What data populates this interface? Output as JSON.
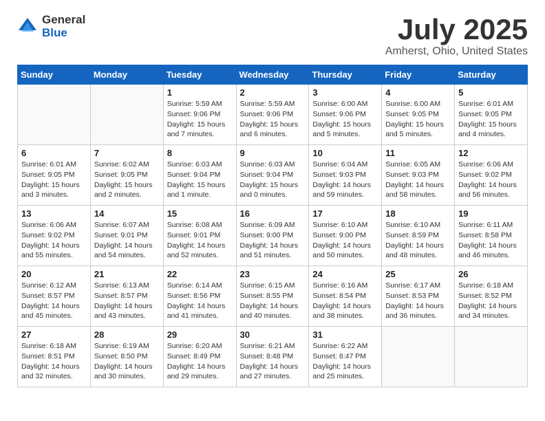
{
  "logo": {
    "general": "General",
    "blue": "Blue"
  },
  "title": "July 2025",
  "location": "Amherst, Ohio, United States",
  "days_of_week": [
    "Sunday",
    "Monday",
    "Tuesday",
    "Wednesday",
    "Thursday",
    "Friday",
    "Saturday"
  ],
  "weeks": [
    [
      {
        "day": "",
        "info": ""
      },
      {
        "day": "",
        "info": ""
      },
      {
        "day": "1",
        "info": "Sunrise: 5:59 AM\nSunset: 9:06 PM\nDaylight: 15 hours\nand 7 minutes."
      },
      {
        "day": "2",
        "info": "Sunrise: 5:59 AM\nSunset: 9:06 PM\nDaylight: 15 hours\nand 6 minutes."
      },
      {
        "day": "3",
        "info": "Sunrise: 6:00 AM\nSunset: 9:06 PM\nDaylight: 15 hours\nand 5 minutes."
      },
      {
        "day": "4",
        "info": "Sunrise: 6:00 AM\nSunset: 9:05 PM\nDaylight: 15 hours\nand 5 minutes."
      },
      {
        "day": "5",
        "info": "Sunrise: 6:01 AM\nSunset: 9:05 PM\nDaylight: 15 hours\nand 4 minutes."
      }
    ],
    [
      {
        "day": "6",
        "info": "Sunrise: 6:01 AM\nSunset: 9:05 PM\nDaylight: 15 hours\nand 3 minutes."
      },
      {
        "day": "7",
        "info": "Sunrise: 6:02 AM\nSunset: 9:05 PM\nDaylight: 15 hours\nand 2 minutes."
      },
      {
        "day": "8",
        "info": "Sunrise: 6:03 AM\nSunset: 9:04 PM\nDaylight: 15 hours\nand 1 minute."
      },
      {
        "day": "9",
        "info": "Sunrise: 6:03 AM\nSunset: 9:04 PM\nDaylight: 15 hours\nand 0 minutes."
      },
      {
        "day": "10",
        "info": "Sunrise: 6:04 AM\nSunset: 9:03 PM\nDaylight: 14 hours\nand 59 minutes."
      },
      {
        "day": "11",
        "info": "Sunrise: 6:05 AM\nSunset: 9:03 PM\nDaylight: 14 hours\nand 58 minutes."
      },
      {
        "day": "12",
        "info": "Sunrise: 6:06 AM\nSunset: 9:02 PM\nDaylight: 14 hours\nand 56 minutes."
      }
    ],
    [
      {
        "day": "13",
        "info": "Sunrise: 6:06 AM\nSunset: 9:02 PM\nDaylight: 14 hours\nand 55 minutes."
      },
      {
        "day": "14",
        "info": "Sunrise: 6:07 AM\nSunset: 9:01 PM\nDaylight: 14 hours\nand 54 minutes."
      },
      {
        "day": "15",
        "info": "Sunrise: 6:08 AM\nSunset: 9:01 PM\nDaylight: 14 hours\nand 52 minutes."
      },
      {
        "day": "16",
        "info": "Sunrise: 6:09 AM\nSunset: 9:00 PM\nDaylight: 14 hours\nand 51 minutes."
      },
      {
        "day": "17",
        "info": "Sunrise: 6:10 AM\nSunset: 9:00 PM\nDaylight: 14 hours\nand 50 minutes."
      },
      {
        "day": "18",
        "info": "Sunrise: 6:10 AM\nSunset: 8:59 PM\nDaylight: 14 hours\nand 48 minutes."
      },
      {
        "day": "19",
        "info": "Sunrise: 6:11 AM\nSunset: 8:58 PM\nDaylight: 14 hours\nand 46 minutes."
      }
    ],
    [
      {
        "day": "20",
        "info": "Sunrise: 6:12 AM\nSunset: 8:57 PM\nDaylight: 14 hours\nand 45 minutes."
      },
      {
        "day": "21",
        "info": "Sunrise: 6:13 AM\nSunset: 8:57 PM\nDaylight: 14 hours\nand 43 minutes."
      },
      {
        "day": "22",
        "info": "Sunrise: 6:14 AM\nSunset: 8:56 PM\nDaylight: 14 hours\nand 41 minutes."
      },
      {
        "day": "23",
        "info": "Sunrise: 6:15 AM\nSunset: 8:55 PM\nDaylight: 14 hours\nand 40 minutes."
      },
      {
        "day": "24",
        "info": "Sunrise: 6:16 AM\nSunset: 8:54 PM\nDaylight: 14 hours\nand 38 minutes."
      },
      {
        "day": "25",
        "info": "Sunrise: 6:17 AM\nSunset: 8:53 PM\nDaylight: 14 hours\nand 36 minutes."
      },
      {
        "day": "26",
        "info": "Sunrise: 6:18 AM\nSunset: 8:52 PM\nDaylight: 14 hours\nand 34 minutes."
      }
    ],
    [
      {
        "day": "27",
        "info": "Sunrise: 6:18 AM\nSunset: 8:51 PM\nDaylight: 14 hours\nand 32 minutes."
      },
      {
        "day": "28",
        "info": "Sunrise: 6:19 AM\nSunset: 8:50 PM\nDaylight: 14 hours\nand 30 minutes."
      },
      {
        "day": "29",
        "info": "Sunrise: 6:20 AM\nSunset: 8:49 PM\nDaylight: 14 hours\nand 29 minutes."
      },
      {
        "day": "30",
        "info": "Sunrise: 6:21 AM\nSunset: 8:48 PM\nDaylight: 14 hours\nand 27 minutes."
      },
      {
        "day": "31",
        "info": "Sunrise: 6:22 AM\nSunset: 8:47 PM\nDaylight: 14 hours\nand 25 minutes."
      },
      {
        "day": "",
        "info": ""
      },
      {
        "day": "",
        "info": ""
      }
    ]
  ]
}
